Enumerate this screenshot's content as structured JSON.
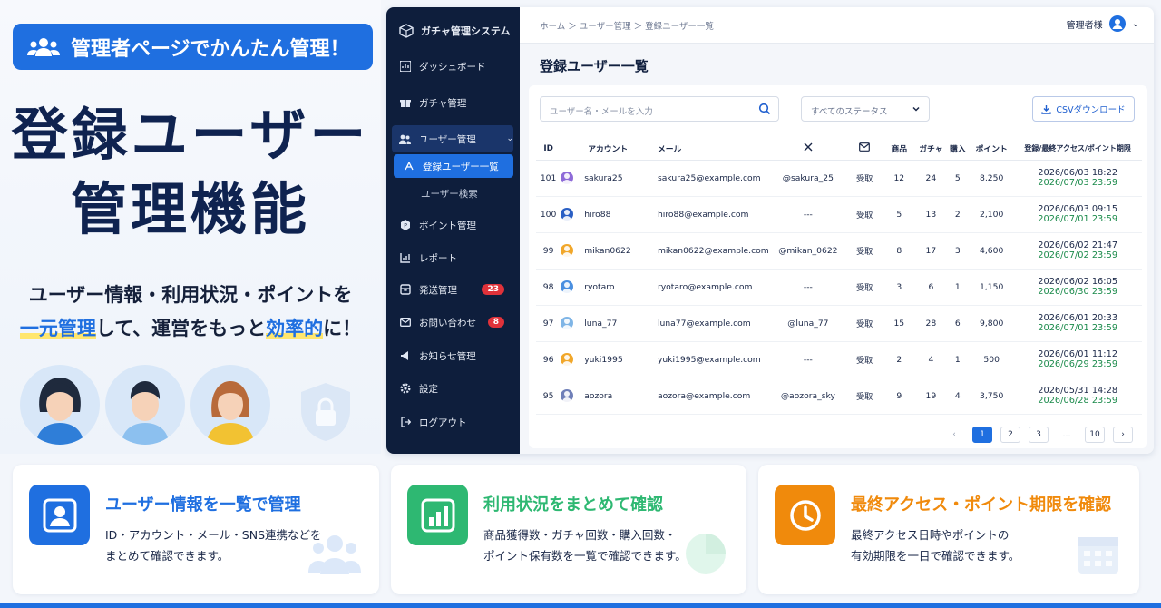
{
  "promo": {
    "badge": "管理者ページでかんたん管理！",
    "title_line1": "登録ユーザー",
    "title_line2": "管理機能",
    "sub_line1": "ユーザー情報・利用状況・ポイントを",
    "sub_hl1": "一元管理",
    "sub_mid": "して、運営をもっと",
    "sub_hl2": "効率的",
    "sub_end": "に！"
  },
  "sidebar": {
    "brand": "ガチャ管理システム",
    "items": [
      {
        "label": "ダッシュボード",
        "icon": "dashboard-icon"
      },
      {
        "label": "ガチャ管理",
        "icon": "gift-icon"
      },
      {
        "label": "ユーザー管理",
        "icon": "users-icon"
      },
      {
        "label": "登録ユーザー一覧",
        "icon": "list-icon"
      },
      {
        "label": "ユーザー検索",
        "icon": ""
      },
      {
        "label": "ポイント管理",
        "icon": "coin-icon"
      },
      {
        "label": "レポート",
        "icon": "chart-icon"
      },
      {
        "label": "発送管理",
        "icon": "box-icon",
        "badge": "23"
      },
      {
        "label": "お問い合わせ",
        "icon": "mail-icon",
        "badge": "8"
      },
      {
        "label": "お知らせ管理",
        "icon": "megaphone-icon"
      },
      {
        "label": "設定",
        "icon": "gear-icon"
      },
      {
        "label": "ログアウト",
        "icon": "logout-icon"
      }
    ]
  },
  "topbar": {
    "breadcrumb": "ホーム ＞ ユーザー管理 ＞ 登録ユーザー一覧",
    "user": "管理者様"
  },
  "main": {
    "title": "登録ユーザー一覧",
    "search_placeholder": "ユーザー名・メールを入力",
    "status_select": "すべてのステータス",
    "csv_button": "CSVダウンロード"
  },
  "table": {
    "headers": {
      "id": "ID",
      "account": "アカウント",
      "mail": "メール",
      "items": "商品",
      "gacha": "ガチャ",
      "purchase": "購入",
      "points": "ポイント",
      "access": "登録/最終アクセス/ポイント期限"
    },
    "rows": [
      {
        "id": "101",
        "account": "sakura25",
        "email": "sakura25@example.com",
        "x": "@sakura_25",
        "mail": "受取",
        "items": "12",
        "gacha": "24",
        "purchase": "5",
        "points": "8,250",
        "last": "2026/06/03 18:22",
        "expire": "2026/07/03 23:59",
        "color": "#8e6bd8"
      },
      {
        "id": "100",
        "account": "hiro88",
        "email": "hiro88@example.com",
        "x": "---",
        "mail": "受取",
        "items": "5",
        "gacha": "13",
        "purchase": "2",
        "points": "2,100",
        "last": "2026/06/03 09:15",
        "expire": "2026/07/01 23:59",
        "color": "#2a5fc4"
      },
      {
        "id": "99",
        "account": "mikan0622",
        "email": "mikan0622@example.com",
        "x": "@mikan_0622",
        "mail": "受取",
        "items": "8",
        "gacha": "17",
        "purchase": "3",
        "points": "4,600",
        "last": "2026/06/02 21:47",
        "expire": "2026/07/02 23:59",
        "color": "#f1a72a"
      },
      {
        "id": "98",
        "account": "ryotaro",
        "email": "ryotaro@example.com",
        "x": "---",
        "mail": "受取",
        "items": "3",
        "gacha": "6",
        "purchase": "1",
        "points": "1,150",
        "last": "2026/06/02 16:05",
        "expire": "2026/06/30 23:59",
        "color": "#4a8fe0"
      },
      {
        "id": "97",
        "account": "luna_77",
        "email": "luna77@example.com",
        "x": "@luna_77",
        "mail": "受取",
        "items": "15",
        "gacha": "28",
        "purchase": "6",
        "points": "9,800",
        "last": "2026/06/01 20:33",
        "expire": "2026/07/01 23:59",
        "color": "#7fb5e6"
      },
      {
        "id": "96",
        "account": "yuki1995",
        "email": "yuki1995@example.com",
        "x": "---",
        "mail": "受取",
        "items": "2",
        "gacha": "4",
        "purchase": "1",
        "points": "500",
        "last": "2026/06/01 11:12",
        "expire": "2026/06/29 23:59",
        "color": "#f1a72a"
      },
      {
        "id": "95",
        "account": "aozora",
        "email": "aozora@example.com",
        "x": "@aozora_sky",
        "mail": "受取",
        "items": "9",
        "gacha": "19",
        "purchase": "4",
        "points": "3,750",
        "last": "2026/05/31 14:28",
        "expire": "2026/06/28 23:59",
        "color": "#6f7fb8"
      }
    ]
  },
  "pagination": {
    "pages": [
      "1",
      "2",
      "3",
      "…",
      "10"
    ],
    "current": "1"
  },
  "features": [
    {
      "title": "ユーザー情報を一覧で管理",
      "line1": "ID・アカウント・メール・SNS連携などを",
      "line2": "まとめて確認できます。",
      "color": "#1f6fe0"
    },
    {
      "title": "利用状況をまとめて確認",
      "line1": "商品獲得数・ガチャ回数・購入回数・",
      "line2": "ポイント保有数を一覧で確認できます。",
      "color": "#2eb872"
    },
    {
      "title": "最終アクセス・ポイント期限を確認",
      "line1": "最終アクセス日時やポイントの",
      "line2": "有効期限を一目で確認できます。",
      "color": "#f08a0c"
    }
  ]
}
